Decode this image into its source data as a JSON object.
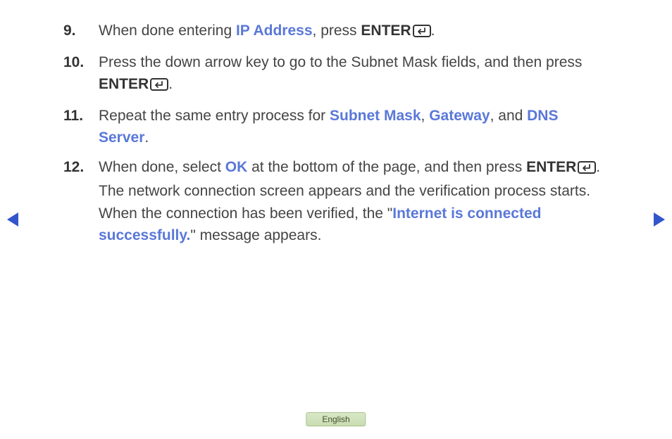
{
  "items": [
    {
      "num": "9.",
      "segments": [
        {
          "t": "When done entering ",
          "cls": ""
        },
        {
          "t": "IP Address",
          "cls": "link"
        },
        {
          "t": ", press ",
          "cls": ""
        },
        {
          "t": "ENTER",
          "cls": "bold"
        },
        {
          "t": "ICON",
          "cls": "enter"
        },
        {
          "t": ".",
          "cls": ""
        }
      ]
    },
    {
      "num": "10.",
      "segments": [
        {
          "t": "Press the down arrow key to go to the Subnet Mask fields, and then press ",
          "cls": ""
        },
        {
          "t": "ENTER",
          "cls": "bold"
        },
        {
          "t": "ICON",
          "cls": "enter"
        },
        {
          "t": ".",
          "cls": ""
        }
      ]
    },
    {
      "num": "11.",
      "segments": [
        {
          "t": "Repeat the same entry process for ",
          "cls": ""
        },
        {
          "t": "Subnet Mask",
          "cls": "link"
        },
        {
          "t": ", ",
          "cls": ""
        },
        {
          "t": "Gateway",
          "cls": "link"
        },
        {
          "t": ", and ",
          "cls": ""
        },
        {
          "t": "DNS Server",
          "cls": "link"
        },
        {
          "t": ".",
          "cls": ""
        }
      ]
    },
    {
      "num": "12.",
      "segments": [
        {
          "t": "When done, select ",
          "cls": ""
        },
        {
          "t": "OK",
          "cls": "link"
        },
        {
          "t": " at the bottom of the page, and then press ",
          "cls": ""
        },
        {
          "t": "ENTER",
          "cls": "bold"
        },
        {
          "t": "ICON",
          "cls": "enter"
        },
        {
          "t": ". The network connection screen appears and the verification process starts. When the connection has been verified, the \"",
          "cls": ""
        },
        {
          "t": "Internet is connected successfully.",
          "cls": "link"
        },
        {
          "t": "\" message appears.",
          "cls": ""
        }
      ]
    }
  ],
  "language": "English"
}
